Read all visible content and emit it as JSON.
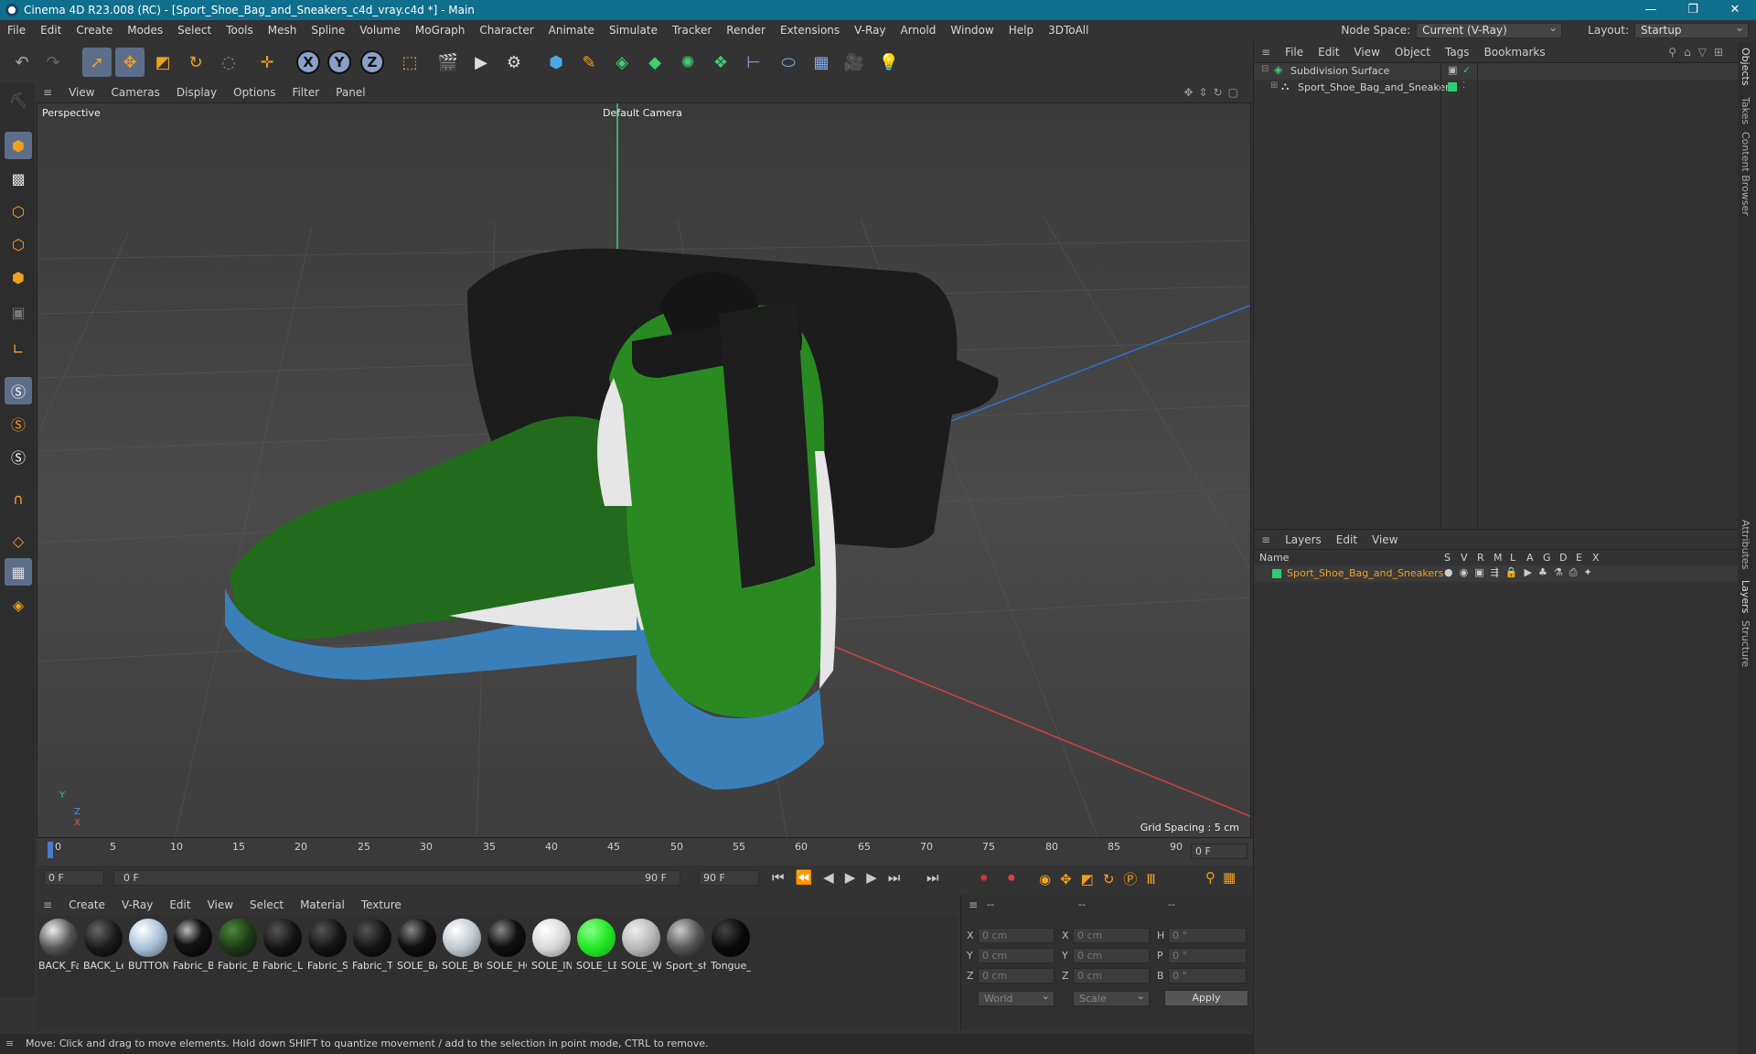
{
  "window": {
    "title": "Cinema 4D R23.008 (RC) - [Sport_Shoe_Bag_and_Sneakers_c4d_vray.c4d *] - Main",
    "controls": [
      "—",
      "❐",
      "✕"
    ]
  },
  "menubar": {
    "items": [
      "File",
      "Edit",
      "Create",
      "Modes",
      "Select",
      "Tools",
      "Mesh",
      "Spline",
      "Volume",
      "MoGraph",
      "Character",
      "Animate",
      "Simulate",
      "Tracker",
      "Render",
      "Extensions",
      "V-Ray",
      "Arnold",
      "Window",
      "Help",
      "3DToAll"
    ],
    "node_space_label": "Node Space:",
    "node_space_value": "Current (V-Ray)",
    "layout_label": "Layout:",
    "layout_value": "Startup"
  },
  "toolbar": {
    "axis_labels": [
      "X",
      "Y",
      "Z"
    ]
  },
  "viewport": {
    "menu": [
      "View",
      "Cameras",
      "Display",
      "Options",
      "Filter",
      "Panel"
    ],
    "view_name": "Perspective",
    "camera": "Default Camera",
    "grid_spacing": "Grid Spacing : 5 cm",
    "axis_y": "Y",
    "axis_x": "X",
    "axis_z": "Z"
  },
  "timeline": {
    "ticks": [
      "0",
      "5",
      "10",
      "15",
      "20",
      "25",
      "30",
      "35",
      "40",
      "45",
      "50",
      "55",
      "60",
      "65",
      "70",
      "75",
      "80",
      "85",
      "90"
    ],
    "current_frame": "0 F",
    "start": "0 F",
    "range_start": "0 F",
    "range_end": "90 F",
    "end": "90 F"
  },
  "materials": {
    "menu": [
      "Create",
      "V-Ray",
      "Edit",
      "View",
      "Select",
      "Material",
      "Texture"
    ],
    "items": [
      {
        "name": "BACK_Fa",
        "color": "#9a9a9a"
      },
      {
        "name": "BACK_Le",
        "color": "#1a1a1a"
      },
      {
        "name": "BUTTON",
        "color": "#c8d8e8"
      },
      {
        "name": "Fabric_B",
        "color": "#141414"
      },
      {
        "name": "Fabric_Bl",
        "color": "#1d3a16"
      },
      {
        "name": "Fabric_Lc",
        "color": "#141414"
      },
      {
        "name": "Fabric_Sl",
        "color": "#141414"
      },
      {
        "name": "Fabric_Tc",
        "color": "#141414"
      },
      {
        "name": "SOLE_BA",
        "color": "#111111"
      },
      {
        "name": "SOLE_BC",
        "color": "#c0c8d0"
      },
      {
        "name": "SOLE_HC",
        "color": "#111111"
      },
      {
        "name": "SOLE_IN",
        "color": "#d8d8d8"
      },
      {
        "name": "SOLE_LE",
        "color": "#22e822"
      },
      {
        "name": "SOLE_W",
        "color": "#b8b8b8"
      },
      {
        "name": "Sport_sh",
        "color": "#555555"
      },
      {
        "name": "Tongue_",
        "color": "#0a0a0a"
      }
    ]
  },
  "coords": {
    "headers": [
      "--",
      "--",
      "--"
    ],
    "rows": [
      {
        "l1": "X",
        "v1": "0 cm",
        "l2": "X",
        "v2": "0 cm",
        "l3": "H",
        "v3": "0 °"
      },
      {
        "l1": "Y",
        "v1": "0 cm",
        "l2": "Y",
        "v2": "0 cm",
        "l3": "P",
        "v3": "0 °"
      },
      {
        "l1": "Z",
        "v1": "0 cm",
        "l2": "Z",
        "v2": "0 cm",
        "l3": "B",
        "v3": "0 °"
      }
    ],
    "space": "World",
    "mode": "Scale",
    "apply": "Apply"
  },
  "objects": {
    "menu": [
      "File",
      "Edit",
      "View",
      "Object",
      "Tags",
      "Bookmarks"
    ],
    "items": [
      {
        "name": "Subdivision Surface"
      },
      {
        "name": "Sport_Shoe_Bag_and_Sneakers"
      }
    ]
  },
  "layers": {
    "menu": [
      "Layers",
      "Edit",
      "View"
    ],
    "name_header": "Name",
    "flag_headers": [
      "S",
      "V",
      "R",
      "M",
      "L",
      "A",
      "G",
      "D",
      "E",
      "X"
    ],
    "items": [
      {
        "name": "Sport_Shoe_Bag_and_Sneakers",
        "color": "#2ecc71"
      }
    ]
  },
  "side_tabs": [
    "Objects",
    "Takes",
    "Content Browser",
    "Attributes",
    "Layers",
    "Structure"
  ],
  "status": "Move: Click and drag to move elements. Hold down SHIFT to quantize movement / add to the selection in point mode, CTRL to remove."
}
